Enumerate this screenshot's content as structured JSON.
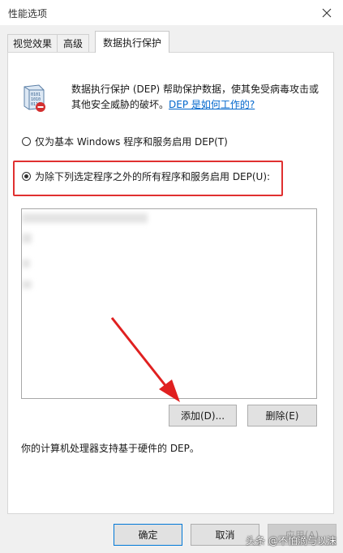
{
  "window": {
    "title": "性能选项"
  },
  "tabs": [
    {
      "label": "视觉效果"
    },
    {
      "label": "高级"
    },
    {
      "label": "数据执行保护"
    }
  ],
  "description": {
    "text_line1": "数据执行保护 (DEP) 帮助保护数据，使其免受病毒攻击或",
    "text_line2": "其他安全威胁的破坏。",
    "link": "DEP 是如何工作的?"
  },
  "options": {
    "basic": "仅为基本 Windows 程序和服务启用 DEP(T)",
    "all_except": "为除下列选定程序之外的所有程序和服务启用 DEP(U):",
    "selected": "all_except"
  },
  "list_buttons": {
    "add": "添加(D)...",
    "remove": "删除(E)"
  },
  "hardware_note": "你的计算机处理器支持基于硬件的 DEP。",
  "footer": {
    "ok": "确定",
    "cancel": "取消",
    "apply": "应用(A)"
  },
  "watermark": "头条 @不怕滴与以沫",
  "colors": {
    "highlight": "#e03030",
    "link": "#0066cc",
    "focus": "#0078d7"
  }
}
